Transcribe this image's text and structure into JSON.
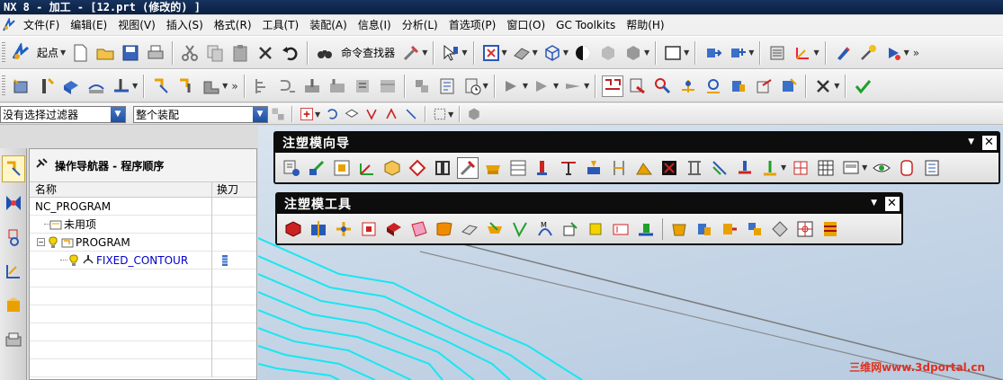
{
  "window": {
    "title": "NX 8 - 加工 - [12.prt (修改的) ]"
  },
  "menu": [
    "文件(F)",
    "编辑(E)",
    "视图(V)",
    "插入(S)",
    "格式(R)",
    "工具(T)",
    "装配(A)",
    "信息(I)",
    "分析(L)",
    "首选项(P)",
    "窗口(O)",
    "GC Toolkits",
    "帮助(H)"
  ],
  "toolbar1": {
    "start_label": "起点",
    "command_finder_label": "命令查找器"
  },
  "filters": {
    "selection_filter": "没有选择过滤器",
    "assembly_scope": "整个装配"
  },
  "navigator": {
    "title": "操作导航器 - 程序顺序",
    "col_name": "名称",
    "col_tool": "换刀",
    "root": "NC_PROGRAM",
    "unused": "未用项",
    "program": "PROGRAM",
    "operation": "FIXED_CONTOUR"
  },
  "palettes": {
    "mold_wizard": "注塑模向导",
    "mold_tools": "注塑模工具"
  },
  "watermark": "三维网www.3dportal.cn",
  "colors": {
    "toolpath": "#19e6f0",
    "title_bar": "#0b1f40",
    "accent_blue": "#1c4fa3"
  }
}
